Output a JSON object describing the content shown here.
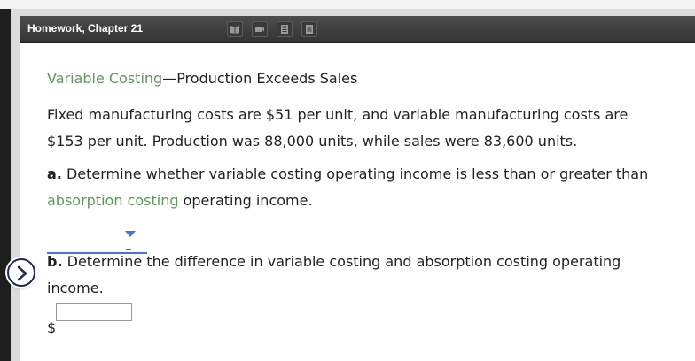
{
  "window": {
    "title": "Homework, Chapter 21"
  },
  "toolbar": {
    "icons": [
      "book-icon",
      "video-icon",
      "calculator-icon",
      "document-icon"
    ]
  },
  "problem": {
    "title_link": "Variable Costing",
    "title_rest": "—Production Exceeds Sales",
    "intro_line1": "Fixed manufacturing costs are $51 per unit, and variable manufacturing costs are",
    "intro_line2": "$153 per unit. Production was 88,000 units, while sales were 83,600 units.",
    "part_a": {
      "label": "a.",
      "line1": " Determine whether variable costing operating income is less than or greater than",
      "link": "absorption costing",
      "line2_rest": " operating income.",
      "selected_value": ""
    },
    "part_b": {
      "label": "b.",
      "line1": " Determine the difference in variable costing and absorption costing operating",
      "line2": "income.",
      "currency": "$",
      "value": ""
    }
  },
  "colors": {
    "accent_green": "#5a9a5a",
    "select_blue": "#3b7bd4",
    "titlebar": "#3c3c3c"
  }
}
